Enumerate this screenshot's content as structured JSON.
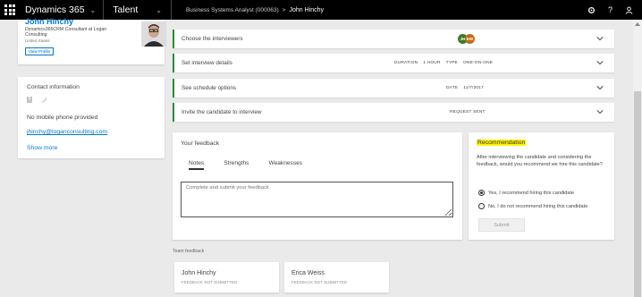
{
  "topbar": {
    "app_name": "Dynamics 365",
    "module": "Talent",
    "breadcrumb_parent": "Business Systems Analyst (000063)",
    "breadcrumb_sep": ">",
    "breadcrumb_current": "John Hinchy",
    "settings_icon": "gear-icon",
    "help_label": "?",
    "user_icon": "person-icon"
  },
  "profile": {
    "name": "John Hinchy",
    "title": "Dynamics365CRM Consultant at Logan Consulting",
    "location": "United States",
    "view_profile": "View Profile"
  },
  "contact": {
    "heading": "Contact information",
    "no_phone": "No mobile phone provided",
    "email": "jhinchy@loganconsulting.com",
    "show_more": "Show more"
  },
  "steps": [
    {
      "title": "Choose the interviewers",
      "avatars": [
        "JH",
        "EW"
      ],
      "avatar_colors": [
        "#3a7d1e",
        "#c46a1a"
      ]
    },
    {
      "title": "Set interview details",
      "meta_duration_label": "DURATION",
      "meta_duration_value": "1 HOUR",
      "meta_type_label": "TYPE",
      "meta_type_value": "ONE-ON-ONE"
    },
    {
      "title": "See schedule options",
      "meta_date_label": "DATE",
      "meta_date_value": "11/7/2017"
    },
    {
      "title": "Invite the candidate to interview",
      "meta_status": "REQUEST SENT"
    }
  ],
  "feedback": {
    "title": "Your feedback",
    "tabs": [
      "Notes",
      "Strengths",
      "Weaknesses"
    ],
    "active_tab": "Notes",
    "placeholder": "Complete and submit your feedback"
  },
  "recommendation": {
    "title": "Recommendation",
    "question": "After interviewing the candidate and considering the feedback, would you recommend we hire this candidate?",
    "option_yes": "Yes, I recommend hiring this candidate",
    "option_no": "No, I do not recommend hiring this candidate",
    "selected": "yes",
    "submit": "Submit"
  },
  "team": {
    "label": "Team feedback",
    "members": [
      {
        "name": "John Hinchy",
        "status": "FEEDBACK NOT SUBMITTED"
      },
      {
        "name": "Erica Weiss",
        "status": "FEEDBACK NOT SUBMITTED"
      }
    ]
  }
}
